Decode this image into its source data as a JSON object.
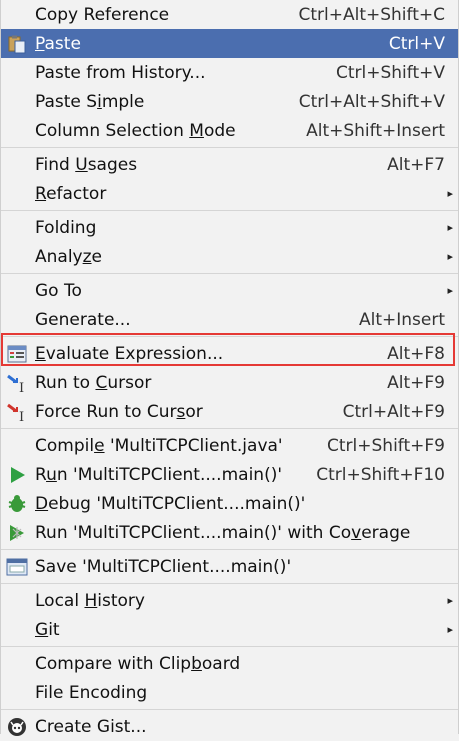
{
  "menu": {
    "items": [
      {
        "type": "item",
        "name": "copy-reference",
        "pre": "Copy Reference",
        "u": "",
        "post": "",
        "shortcut": "Ctrl+Alt+Shift+C"
      },
      {
        "type": "item",
        "name": "paste",
        "pre": "",
        "u": "P",
        "post": "aste",
        "shortcut": "Ctrl+V",
        "icon": "clipboard-paste-icon",
        "highlight": true
      },
      {
        "type": "item",
        "name": "paste-from-history",
        "pre": "Paste from History...",
        "u": "",
        "post": "",
        "shortcut": "Ctrl+Shift+V"
      },
      {
        "type": "item",
        "name": "paste-simple",
        "pre": "Paste S",
        "u": "i",
        "post": "mple",
        "shortcut": "Ctrl+Alt+Shift+V"
      },
      {
        "type": "item",
        "name": "column-selection-mode",
        "pre": "Column Selection ",
        "u": "M",
        "post": "ode",
        "shortcut": "Alt+Shift+Insert"
      },
      {
        "type": "sep"
      },
      {
        "type": "item",
        "name": "find-usages",
        "pre": "Find ",
        "u": "U",
        "post": "sages",
        "shortcut": "Alt+F7"
      },
      {
        "type": "item",
        "name": "refactor",
        "pre": "",
        "u": "R",
        "post": "efactor",
        "submenu": true
      },
      {
        "type": "sep"
      },
      {
        "type": "item",
        "name": "folding",
        "pre": "Folding",
        "u": "",
        "post": "",
        "submenu": true
      },
      {
        "type": "item",
        "name": "analyze",
        "pre": "Analy",
        "u": "z",
        "post": "e",
        "submenu": true
      },
      {
        "type": "sep"
      },
      {
        "type": "item",
        "name": "go-to",
        "pre": "Go To",
        "u": "",
        "post": "",
        "submenu": true
      },
      {
        "type": "item",
        "name": "generate",
        "pre": "Generate...",
        "u": "",
        "post": "",
        "shortcut": "Alt+Insert"
      },
      {
        "type": "sep"
      },
      {
        "type": "item",
        "name": "evaluate-expression",
        "pre": "",
        "u": "E",
        "post": "valuate Expression...",
        "shortcut": "Alt+F8",
        "icon": "evaluate-calculator-icon"
      },
      {
        "type": "item",
        "name": "run-to-cursor",
        "pre": "Run to ",
        "u": "C",
        "post": "ursor",
        "shortcut": "Alt+F9",
        "icon": "run-to-cursor-icon"
      },
      {
        "type": "item",
        "name": "force-run-to-cursor",
        "pre": "Force Run to Cur",
        "u": "s",
        "post": "or",
        "shortcut": "Ctrl+Alt+F9",
        "icon": "force-run-to-cursor-icon"
      },
      {
        "type": "sep"
      },
      {
        "type": "item",
        "name": "compile",
        "pre": "Compil",
        "u": "e",
        "post": " 'MultiTCPClient.java'",
        "shortcut": "Ctrl+Shift+F9"
      },
      {
        "type": "item",
        "name": "run",
        "pre": "R",
        "u": "u",
        "post": "n 'MultiTCPClient....main()'",
        "shortcut": "Ctrl+Shift+F10",
        "icon": "run-play-icon"
      },
      {
        "type": "item",
        "name": "debug",
        "pre": "",
        "u": "D",
        "post": "ebug 'MultiTCPClient....main()'",
        "icon": "debug-bug-icon"
      },
      {
        "type": "item",
        "name": "run-with-coverage",
        "pre": "Run 'MultiTCPClient....main()' with Co",
        "u": "v",
        "post": "erage",
        "icon": "coverage-icon"
      },
      {
        "type": "sep"
      },
      {
        "type": "item",
        "name": "save-run-config",
        "pre": "Save 'MultiTCPClient....main()'",
        "u": "",
        "post": "",
        "icon": "save-config-icon"
      },
      {
        "type": "sep"
      },
      {
        "type": "item",
        "name": "local-history",
        "pre": "Local ",
        "u": "H",
        "post": "istory",
        "submenu": true
      },
      {
        "type": "item",
        "name": "git",
        "pre": "",
        "u": "G",
        "post": "it",
        "submenu": true
      },
      {
        "type": "sep"
      },
      {
        "type": "item",
        "name": "compare-with-clipboard",
        "pre": "Compare with Clip",
        "u": "b",
        "post": "oard"
      },
      {
        "type": "item",
        "name": "file-encoding",
        "pre": "File Encoding",
        "u": "",
        "post": ""
      },
      {
        "type": "sep"
      },
      {
        "type": "item",
        "name": "create-gist",
        "pre": "Create Gist...",
        "u": "",
        "post": "",
        "icon": "github-octocat-icon"
      }
    ],
    "highlight_color": "#4b6eaf",
    "annotation_box_color": "#e53935"
  }
}
